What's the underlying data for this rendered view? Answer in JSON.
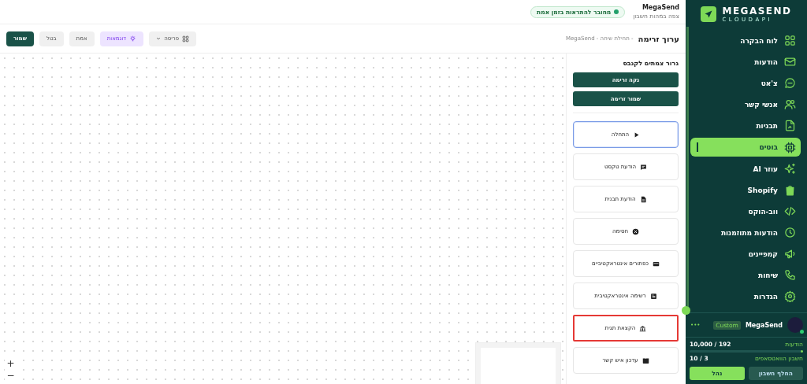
{
  "sidebar": {
    "logo": {
      "name": "MEGASEND",
      "tagline": "CLOUDAPI"
    },
    "items": [
      {
        "label": "לוח הבקרה",
        "selected": false
      },
      {
        "label": "הודעות",
        "selected": false
      },
      {
        "label": "צ'אט",
        "selected": false
      },
      {
        "label": "אנשי קשר",
        "selected": false
      },
      {
        "label": "תבניות",
        "selected": false
      },
      {
        "label": "בוטים",
        "selected": true
      },
      {
        "label": "עוזר AI",
        "selected": false
      },
      {
        "label": "Shopify",
        "selected": false
      },
      {
        "label": "ווב-הוקס",
        "selected": false
      },
      {
        "label": "הודעות מתוזמנות",
        "selected": false
      },
      {
        "label": "קמפיינים",
        "selected": false
      },
      {
        "label": "שיחות",
        "selected": false
      },
      {
        "label": "הגדרות",
        "selected": false
      }
    ],
    "account": {
      "name": "MegaSend",
      "badge": "Custom",
      "menu": "•••",
      "usage": [
        {
          "label": "הודעות",
          "value": "10,000 / 192",
          "level": 0.02
        },
        {
          "label": "חשבון הוואטסאפים",
          "value": "10 / 3"
        }
      ],
      "buttons": [
        {
          "label": "החלף חשבון",
          "kind": "secondary"
        },
        {
          "label": "נהל",
          "kind": "primary"
        }
      ]
    }
  },
  "header": {
    "account": {
      "name": "MegaSend",
      "subtitle": "צפה במהות חשבון"
    },
    "status": "מחובר להתראות בזמן אמת"
  },
  "toolbar": {
    "title": "ערוך זרימה",
    "breadcrumb": "- תחילת שיחה - MegaSend",
    "buttons": [
      {
        "label": "פריסה",
        "kind": "dropdown"
      },
      {
        "label": "דוגמאות",
        "kind": "accent"
      },
      {
        "label": "אמת",
        "kind": "plain"
      },
      {
        "label": "בטל",
        "kind": "plain"
      },
      {
        "label": "שמור",
        "kind": "primary"
      }
    ]
  },
  "palette": {
    "title": "גרור צמתים לקנבס",
    "actions": [
      "נקה זרימה",
      "שמור זרימה"
    ],
    "nodes": [
      {
        "label": "התחלה",
        "selected": true,
        "highlighted": false
      },
      {
        "label": "הודעת טקסט",
        "selected": false,
        "highlighted": false
      },
      {
        "label": "הודעת תבנית",
        "selected": false,
        "highlighted": false
      },
      {
        "label": "חסימה",
        "selected": false,
        "highlighted": false
      },
      {
        "label": "כפתורים אינטראקטיביים",
        "selected": false,
        "highlighted": false
      },
      {
        "label": "רשימה אינטראקטיבית",
        "selected": false,
        "highlighted": false
      },
      {
        "label": "הקצאת תגית",
        "selected": false,
        "highlighted": true
      },
      {
        "label": "עדכון איש קשר",
        "selected": false,
        "highlighted": false
      }
    ]
  },
  "canvas": {
    "zoom_controls": [
      "+",
      "−"
    ]
  }
}
